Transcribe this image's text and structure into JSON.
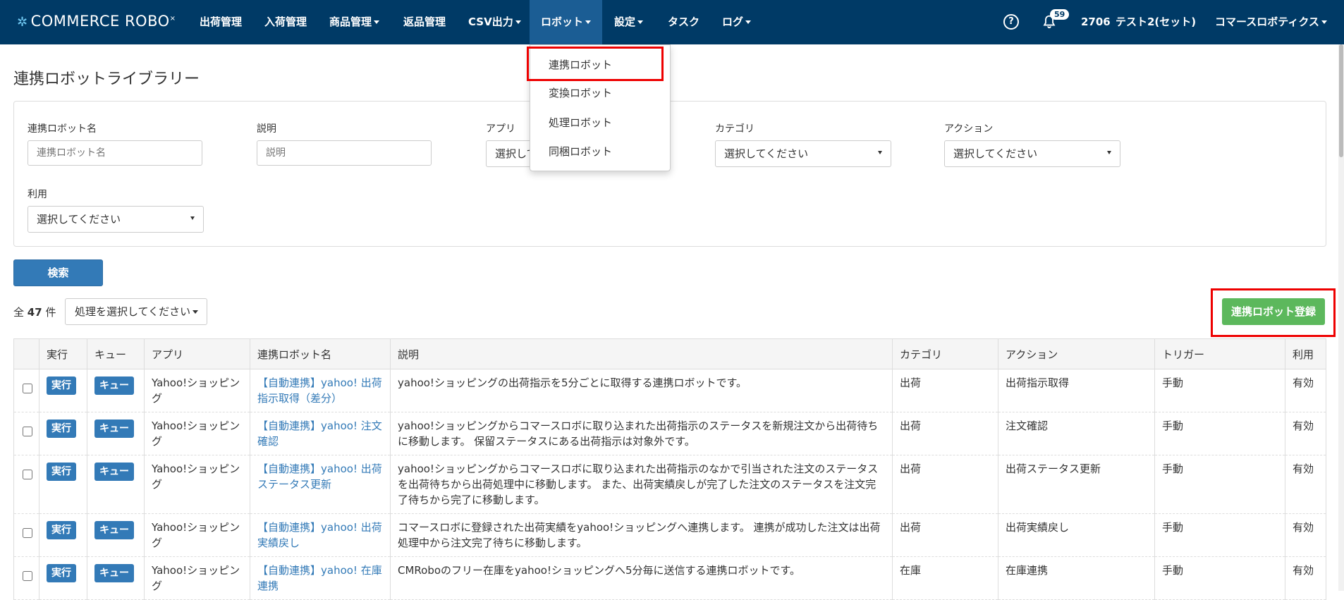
{
  "brand": {
    "logo": "COMMERCE ROBO"
  },
  "nav": {
    "items": [
      "出荷管理",
      "入荷管理",
      "商品管理",
      "返品管理",
      "CSV出力",
      "ロボット",
      "設定",
      "タスク",
      "ログ"
    ],
    "notifications": "59",
    "user_id": "2706",
    "user_name": "テスト2(セット)",
    "company": "コマースロボティクス"
  },
  "dropdown": {
    "items": [
      "連携ロボット",
      "変換ロボット",
      "処理ロボット",
      "同梱ロボット"
    ]
  },
  "page": {
    "title": "連携ロボットライブラリー"
  },
  "filters": {
    "robot_name_label": "連携ロボット名",
    "robot_name_placeholder": "連携ロボット名",
    "description_label": "説明",
    "description_placeholder": "説明",
    "app_label": "アプリ",
    "app_value": "選択して",
    "category_label": "カテゴリ",
    "category_value": "選択してください",
    "action_label": "アクション",
    "action_value": "選択してください",
    "usage_label": "利用",
    "usage_value": "選択してください"
  },
  "search_button": "検索",
  "count": {
    "prefix": "全",
    "value": "47",
    "suffix": "件"
  },
  "process_select": "処理を選択してください",
  "register_button": "連携ロボット登録",
  "table": {
    "headers": [
      "",
      "実行",
      "キュー",
      "アプリ",
      "連携ロボット名",
      "説明",
      "カテゴリ",
      "アクション",
      "トリガー",
      "利用"
    ],
    "run_label": "実行",
    "queue_label": "キュー",
    "rows": [
      {
        "app": "Yahoo!ショッピング",
        "name": "【自動連携】yahoo! 出荷指示取得（差分）",
        "desc": "yahoo!ショッピングの出荷指示を5分ごとに取得する連携ロボットです。",
        "category": "出荷",
        "action": "出荷指示取得",
        "trigger": "手動",
        "usage": "有効"
      },
      {
        "app": "Yahoo!ショッピング",
        "name": "【自動連携】yahoo! 注文確認",
        "desc": "yahoo!ショッピングからコマースロボに取り込まれた出荷指示のステータスを新規注文から出荷待ちに移動します。 保留ステータスにある出荷指示は対象外です。",
        "category": "出荷",
        "action": "注文確認",
        "trigger": "手動",
        "usage": "有効"
      },
      {
        "app": "Yahoo!ショッピング",
        "name": "【自動連携】yahoo! 出荷ステータス更新",
        "desc": "yahoo!ショッピングからコマースロボに取り込まれた出荷指示のなかで引当された注文のステータスを出荷待ちから出荷処理中に移動します。 また、出荷実績戻しが完了した注文のステータスを注文完了待ちから完了に移動します。",
        "category": "出荷",
        "action": "出荷ステータス更新",
        "trigger": "手動",
        "usage": "有効"
      },
      {
        "app": "Yahoo!ショッピング",
        "name": "【自動連携】yahoo! 出荷実績戻し",
        "desc": "コマースロボに登録された出荷実績をyahoo!ショッピングへ連携します。 連携が成功した注文は出荷処理中から注文完了待ちに移動します。",
        "category": "出荷",
        "action": "出荷実績戻し",
        "trigger": "手動",
        "usage": "有効"
      },
      {
        "app": "Yahoo!ショッピング",
        "name": "【自動連携】yahoo! 在庫連携",
        "desc": "CMRoboのフリー在庫をyahoo!ショッピングへ5分毎に送信する連携ロボットです。",
        "category": "在庫",
        "action": "在庫連携",
        "trigger": "手動",
        "usage": "有効"
      }
    ]
  }
}
